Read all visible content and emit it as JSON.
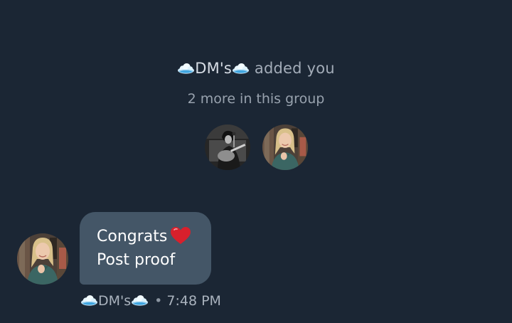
{
  "system_notice": {
    "group_name": "DM's",
    "added_text": "added you",
    "members_text": "2 more in this group",
    "name_icon": "cloud-emoji"
  },
  "members": [
    {
      "avatar": "guitar-player-photo"
    },
    {
      "avatar": "smiling-woman-photo"
    }
  ],
  "message": {
    "sender_avatar": "smiling-woman-photo",
    "lines": [
      "Congrats",
      "Post proof"
    ],
    "emoji": "red-heart-emoji",
    "sender_name": "DM's",
    "separator": "•",
    "time": "7:48 PM"
  },
  "colors": {
    "background": "#1b2634",
    "bubble": "#445667",
    "muted_text": "#a3acb8",
    "heart": "#d8202c"
  }
}
